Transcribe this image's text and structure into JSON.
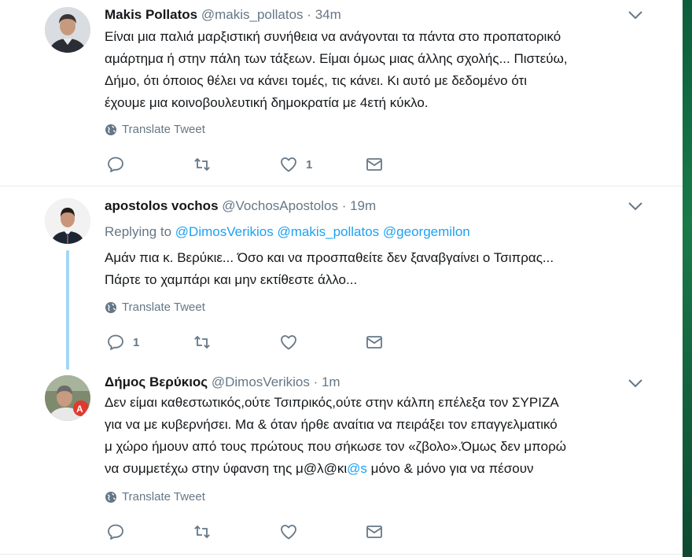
{
  "tweets": [
    {
      "name": "Makis Pollatos",
      "handle": "@makis_pollatos",
      "time": "34m",
      "lines": [
        "Είναι μια παλιά μαρξιστική συνήθεια να ανάγονται τα πάντα στο προπατορικό",
        "αμάρτημα ή στην πάλη των τάξεων. Είμαι όμως μιας άλλης σχολής... Πιστεύω,",
        "Δήμο, ότι όποιος θέλει να κάνει τομές, τις κάνει. Κι αυτό με δεδομένο ότι",
        "έχουμε μια κοινοβουλευτική δημοκρατία με 4ετή κύκλο."
      ],
      "translate": "Translate Tweet",
      "reply_count": "",
      "retweet_count": "",
      "like_count": "1"
    },
    {
      "name": "apostolos vochos",
      "handle": "@VochosApostolos",
      "time": "19m",
      "replying_label": "Replying to",
      "replying_to": [
        "@DimosVerikios",
        "@makis_pollatos",
        "@georgemilon"
      ],
      "lines": [
        "Αμάν πια κ. Βερύκιε... Όσο και να προσπαθείτε δεν ξαναβγαίνει ο Τσιπρας...",
        "Πάρτε το χαμπάρι και μην εκτίθεστε άλλο..."
      ],
      "translate": "Translate Tweet",
      "reply_count": "1",
      "retweet_count": "",
      "like_count": ""
    },
    {
      "name": "Δήμος Βερύκιος",
      "handle": "@DimosVerikios",
      "time": "1m",
      "lines": [
        "Δεν είμαι καθεστωτικός,ούτε Τσιπρικός,ούτε στην κάλπη επέλεξα τον ΣΥΡΙΖΑ",
        "για να με κυβερνήσει. Μα & όταν ήρθε αναίτια να πειράξει τον επαγγελματικό",
        "μ χώρο ήμουν από τους πρώτους που σήκωσε τον «ζβολο».Όμως δεν μπορώ"
      ],
      "last_line_start": "να συμμετέχω στην ύφανση της μ@λ@κι",
      "last_line_link": "@s",
      "last_line_end": " μόνο & μόνο για να πέσουν",
      "translate": "Translate Tweet",
      "reply_count": "",
      "retweet_count": "",
      "like_count": ""
    }
  ],
  "separator": "·",
  "icons": [
    "globe-icon",
    "reply-icon",
    "retweet-icon",
    "like-icon",
    "message-icon",
    "chevron-down-icon"
  ],
  "colors": {
    "link": "#1da1f2",
    "muted": "#657786",
    "thread": "#a3d6f5"
  }
}
